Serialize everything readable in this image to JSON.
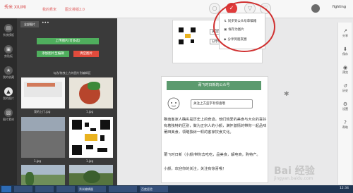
{
  "topbar": {
    "brand": "秀米 XIUMI",
    "nav": [
      "我的秀米",
      "图文排版2.0"
    ],
    "user_name": "fighting",
    "accent": "#e03a3a"
  },
  "popup": {
    "items": [
      {
        "icon": "sync-icon",
        "label": "同步到公众号草稿箱"
      },
      {
        "icon": "copy-icon",
        "label": "保存为图片"
      },
      {
        "icon": "share-icon",
        "label": "分享到朋友圈"
      }
    ]
  },
  "sidebar": {
    "items": [
      {
        "label": "系统模板",
        "icon": "template-icon"
      },
      {
        "label": "剪贴板",
        "icon": "clipboard-icon"
      },
      {
        "label": "我的收藏",
        "icon": "favorite-icon"
      },
      {
        "label": "我的图片",
        "icon": "image-icon"
      },
      {
        "label": "图片素材",
        "icon": "material-icon"
      }
    ]
  },
  "panel": {
    "tab": "全部图片",
    "more": "•••",
    "upload_button": "上传图片(可多选)",
    "add_button": "添加图片至编辑",
    "clear_button": "清空图片",
    "hint": "勾选/拖拽上方的图片到编辑区",
    "images": [
      "我的上门.jpg",
      "1.jpg",
      "1.jpg",
      "1.jpg",
      "1.jpg",
      "1.jpg"
    ]
  },
  "canvas": {
    "header_card_text": [
      "关注我们",
      "分享给朋友"
    ],
    "article_title": "莆飞时日新的公众号",
    "bubble_text": "关注上方蓝字有惊喜哦",
    "paragraphs": [
      "睢南客家人确实是历史上的奇迹，他们热爱的美食与大众的喜好有着独特的区别，做为正宗人的小颜，满怀激情的带你一起品味莆田美食，领略独树一帜的客家饮食文化。",
      "莆飞时日新（小颜/带你去吃吃，品美食，解电商，购特产。",
      "小颜，欢迎你的关注，关注有惊喜哦！"
    ]
  },
  "tools": [
    {
      "icon": "share-arrow-icon",
      "label": "分享"
    },
    {
      "icon": "save-icon",
      "label": "保存"
    },
    {
      "icon": "preview-icon",
      "label": "预览"
    },
    {
      "icon": "history-icon",
      "label": "历史"
    },
    {
      "icon": "settings-icon",
      "label": "设置"
    },
    {
      "icon": "help-icon",
      "label": "帮助"
    }
  ],
  "taskbar": {
    "tasks": [
      "",
      "",
      "",
      "秀米编辑器",
      "",
      "百度经验"
    ],
    "clock": "12:34"
  },
  "watermark": {
    "main": "Bai 经验",
    "sub": "jingyan.baidu.com"
  }
}
